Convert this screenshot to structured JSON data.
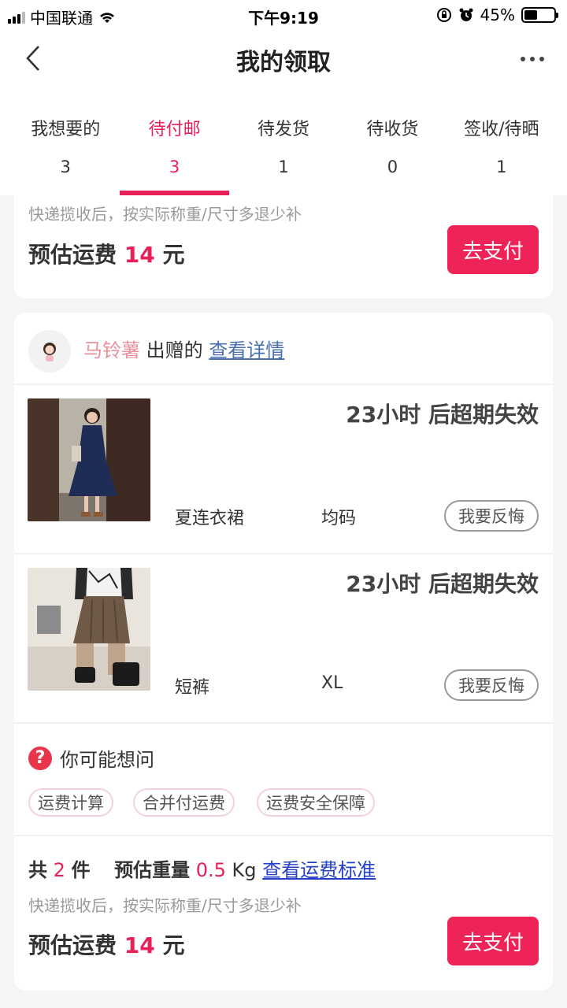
{
  "status_bar": {
    "carrier": "中国联通",
    "time": "下午9:19",
    "battery": "45%",
    "battery_level": 0.45
  },
  "header": {
    "title": "我的领取"
  },
  "tabs": [
    {
      "label": "我想要的",
      "count": "3",
      "active": false
    },
    {
      "label": "待付邮",
      "count": "3",
      "active": true
    },
    {
      "label": "待发货",
      "count": "1",
      "active": false
    },
    {
      "label": "待收货",
      "count": "0",
      "active": false
    },
    {
      "label": "签收/待晒",
      "count": "1",
      "active": false
    }
  ],
  "top_card": {
    "note": "快递揽收后，按实际称重/尺寸多退少补",
    "fee_prefix": "预估运费",
    "fee_amount": "14",
    "fee_unit": "元",
    "pay_label": "去支付"
  },
  "main_card": {
    "giver_name": "马铃薯",
    "giver_suffix": "出赠的",
    "details_link": "查看详情",
    "items": [
      {
        "expire": "23小时 后超期失效",
        "name": "夏连衣裙",
        "size": "均码",
        "regret": "我要反悔"
      },
      {
        "expire": "23小时 后超期失效",
        "name": "短裤",
        "size": "XL",
        "regret": "我要反悔"
      }
    ],
    "faq": {
      "title": "你可能想问",
      "chips": [
        "运费计算",
        "合并付运费",
        "运费安全保障"
      ]
    },
    "summary": {
      "total_prefix": "共",
      "total_count": "2",
      "total_unit": "件",
      "weight_label": "预估重量",
      "weight_value": "0.5",
      "weight_unit": "Kg",
      "standard_link": "查看运费标准",
      "note": "快递揽收后，按实际称重/尺寸多退少补",
      "fee_prefix": "预估运费",
      "fee_amount": "14",
      "fee_unit": "元",
      "pay_label": "去支付"
    }
  },
  "colors": {
    "accent": "#e8205a",
    "pay_button": "#ee2357",
    "giver_name": "#e98f9a",
    "link": "#2440c8"
  }
}
